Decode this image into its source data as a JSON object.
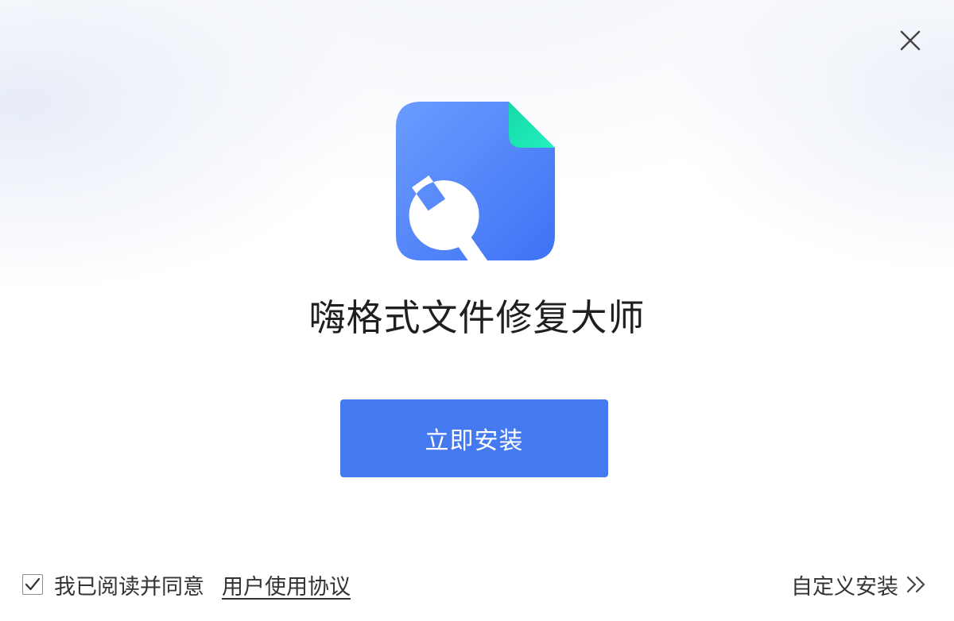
{
  "app": {
    "title": "嗨格式文件修复大师"
  },
  "actions": {
    "install_label": "立即安装",
    "custom_install_label": "自定义安装"
  },
  "agreement": {
    "checked": true,
    "text": "我已阅读并同意",
    "link_text": "用户使用协议"
  },
  "icons": {
    "close": "close-icon",
    "app": "file-wrench-icon",
    "check": "checkmark-icon",
    "chevron": "double-chevron-right-icon"
  },
  "colors": {
    "primary": "#4479f0",
    "icon_gradient_start": "#6b9cff",
    "icon_gradient_end": "#3f72f5",
    "icon_corner": "#17e3b0",
    "text": "#333333"
  }
}
